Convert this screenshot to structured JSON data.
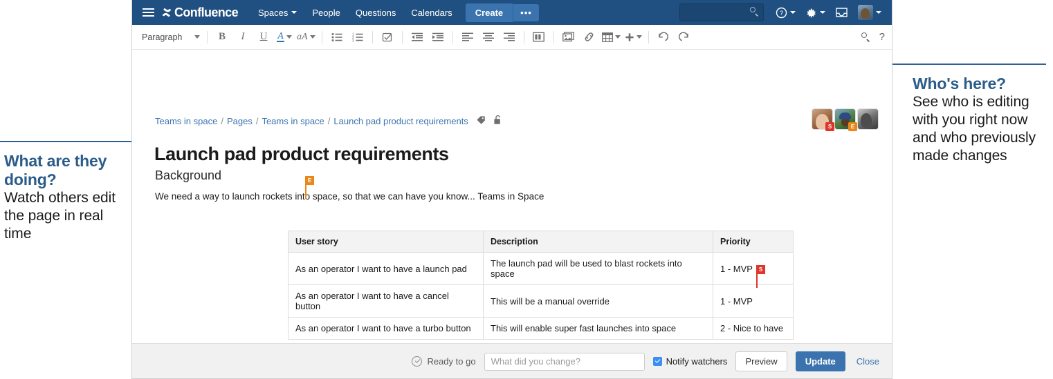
{
  "nav": {
    "brand": "Confluence",
    "hamburger_icon": "hamburger-menu-icon",
    "links": [
      {
        "label": "Spaces",
        "has_caret": true
      },
      {
        "label": "People",
        "has_caret": false
      },
      {
        "label": "Questions",
        "has_caret": false
      },
      {
        "label": "Calendars",
        "has_caret": false
      }
    ],
    "create_label": "Create",
    "create_more_label": "•••",
    "search_placeholder": "",
    "help_icon": "help-circle-icon",
    "settings_icon": "gear-icon",
    "inbox_icon": "inbox-tray-icon",
    "profile_icon": "user-avatar",
    "accent_color": "#205081",
    "create_color": "#3b73af"
  },
  "toolbar": {
    "paragraph_label": "Paragraph",
    "bold_label": "B",
    "italic_label": "I",
    "underline_label": "U",
    "text_color_label": "A",
    "highlight_label": "aA",
    "icons": [
      "bullet-list-icon",
      "numbered-list-icon",
      "task-list-icon",
      "outdent-icon",
      "indent-icon",
      "align-left-icon",
      "align-center-icon",
      "align-right-icon",
      "page-layout-icon",
      "insert-image-icon",
      "insert-link-icon",
      "insert-table-icon",
      "insert-more-icon",
      "undo-icon",
      "redo-icon"
    ],
    "search_icon": "search-icon",
    "help_label": "?"
  },
  "breadcrumb": {
    "items": [
      "Teams in space",
      "Pages",
      "Teams in space",
      "Launch pad product requirements"
    ],
    "separator": "/",
    "tag_icon": "label-tag-icon",
    "lock_icon": "unlocked-padlock-icon"
  },
  "page": {
    "title": "Launch pad product requirements",
    "heading": "Background",
    "paragraph_before_caret": "We ",
    "paragraph_after_caret": "need a way to launch rockets into space, so that we can have you know... Teams in Space"
  },
  "collaborators": {
    "paragraph_caret": {
      "initial": "E",
      "color": "#e8881a"
    },
    "table_caret": {
      "initial": "S",
      "color": "#e0352b"
    },
    "avatars": [
      {
        "name": "avatar-collaborator-1",
        "badge": "S",
        "badge_color": "#e0352b"
      },
      {
        "name": "avatar-collaborator-2",
        "badge": "E",
        "badge_color": "#e8881a"
      },
      {
        "name": "avatar-collaborator-3",
        "badge": "",
        "badge_color": ""
      }
    ]
  },
  "table": {
    "headers": [
      "User story",
      "Description",
      "Priority"
    ],
    "rows": [
      {
        "user_story": "As an operator I want to have a launch pad",
        "description": "The launch pad will be used to blast rockets into space",
        "priority": "1 - MVP"
      },
      {
        "user_story": "As an operator I want to have a cancel button",
        "description": "This will be a manual override",
        "priority": "1 - MVP"
      },
      {
        "user_story": "As an operator I want to have a turbo button",
        "description": "This will enable super fast launches into space",
        "priority": "2 - Nice to have"
      }
    ]
  },
  "footer": {
    "status_label": "Ready to go",
    "status_icon": "check-circle-icon",
    "change_placeholder": "What did you change?",
    "change_value": "",
    "notify_label": "Notify watchers",
    "notify_checked": true,
    "preview_label": "Preview",
    "update_label": "Update",
    "close_label": "Close"
  },
  "annotations": {
    "left": {
      "title": "What are they doing?",
      "body": "Watch others edit the page in real time"
    },
    "right": {
      "title": "Who's here?",
      "body": "See who is editing with you right now and who previously made changes"
    },
    "rule_color": "#2f6193"
  }
}
